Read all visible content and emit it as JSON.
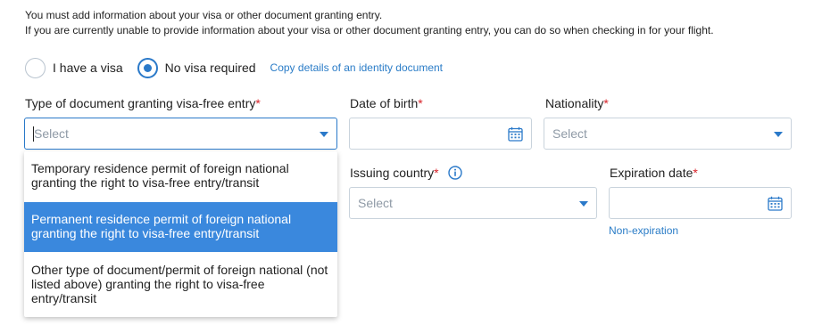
{
  "notice": {
    "line1": "You must add information about your visa or other document granting entry.",
    "line2": "If you are currently unable to provide information about your visa or other document granting entry, you can do so when checking in for your flight."
  },
  "visa_options": {
    "have_visa": "I have a visa",
    "no_visa": "No visa required",
    "selected": "No visa required",
    "copy_link": "Copy details of an identity document"
  },
  "fields": {
    "doc_type": {
      "label": "Type of document granting visa-free entry",
      "required_mark": "*",
      "placeholder": "Select"
    },
    "dob": {
      "label": "Date of birth",
      "required_mark": "*"
    },
    "nationality": {
      "label": "Nationality",
      "required_mark": "*",
      "placeholder": "Select"
    },
    "issuing_country": {
      "label": "Issuing country",
      "required_mark": "*",
      "placeholder": "Select"
    },
    "expiration": {
      "label": "Expiration date",
      "required_mark": "*",
      "link": "Non-expiration"
    }
  },
  "dropdown": {
    "options": [
      {
        "line1": "Temporary residence permit of foreign national",
        "line2": "granting the right to visa-free entry/transit",
        "line3": ""
      },
      {
        "line1": "Permanent residence permit of foreign national",
        "line2": "granting the right to visa-free entry/transit",
        "line3": ""
      },
      {
        "line1": "Other type of document/permit of foreign national (not",
        "line2": "listed above) granting the right to visa-free",
        "line3": "entry/transit"
      }
    ],
    "highlighted_index": 1
  },
  "colors": {
    "accent": "#2a79c9",
    "highlight": "#3a88dd",
    "required": "#d8232a",
    "link": "#2a7cc7"
  },
  "icons": {
    "calendar": "calendar-icon",
    "dropdown": "chevron-down-icon",
    "info": "info-icon"
  }
}
